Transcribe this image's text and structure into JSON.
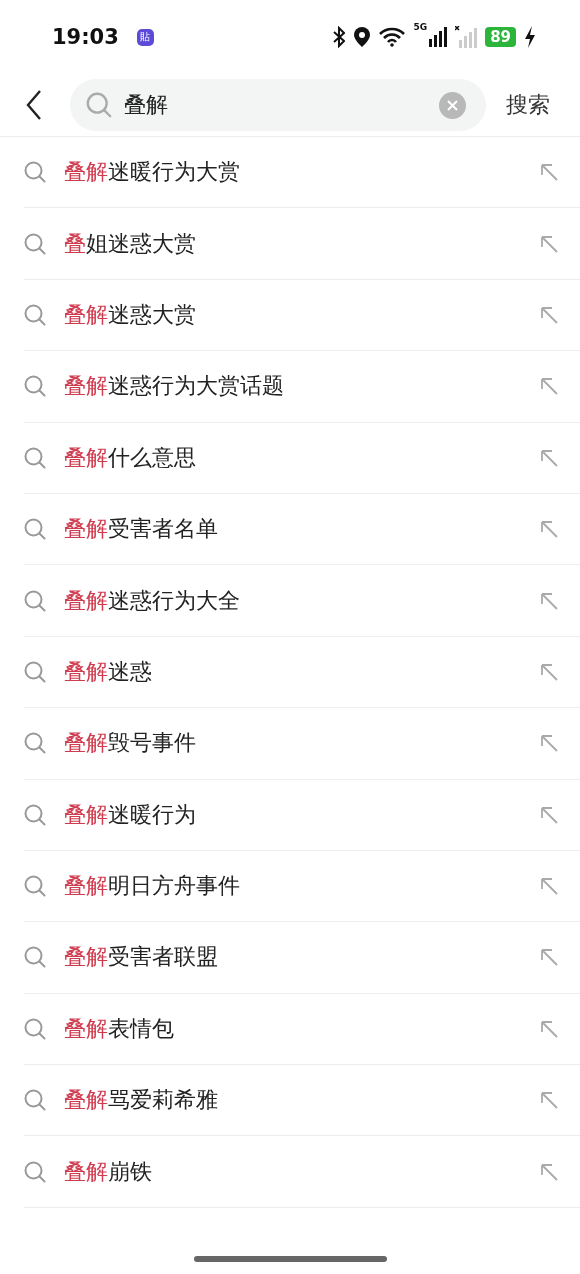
{
  "status_bar": {
    "time": "19:03",
    "app_badge": "貼",
    "network": "5G",
    "battery": "89"
  },
  "search": {
    "value": "叠解",
    "submit": "搜索"
  },
  "suggestions": [
    {
      "match": "叠解",
      "rest": "迷暖行为大赏"
    },
    {
      "match": "叠",
      "rest": "姐迷惑大赏"
    },
    {
      "match": "叠解",
      "rest": "迷惑大赏"
    },
    {
      "match": "叠解",
      "rest": "迷惑行为大赏话题"
    },
    {
      "match": "叠解",
      "rest": "什么意思"
    },
    {
      "match": "叠解",
      "rest": "受害者名单"
    },
    {
      "match": "叠解",
      "rest": "迷惑行为大全"
    },
    {
      "match": "叠解",
      "rest": "迷惑"
    },
    {
      "match": "叠解",
      "rest": "毁号事件"
    },
    {
      "match": "叠解",
      "rest": "迷暖行为"
    },
    {
      "match": "叠解",
      "rest": "明日方舟事件"
    },
    {
      "match": "叠解",
      "rest": "受害者联盟"
    },
    {
      "match": "叠解",
      "rest": "表情包"
    },
    {
      "match": "叠解",
      "rest": "骂爱莉希雅"
    },
    {
      "match": "叠解",
      "rest": "崩铁"
    }
  ]
}
